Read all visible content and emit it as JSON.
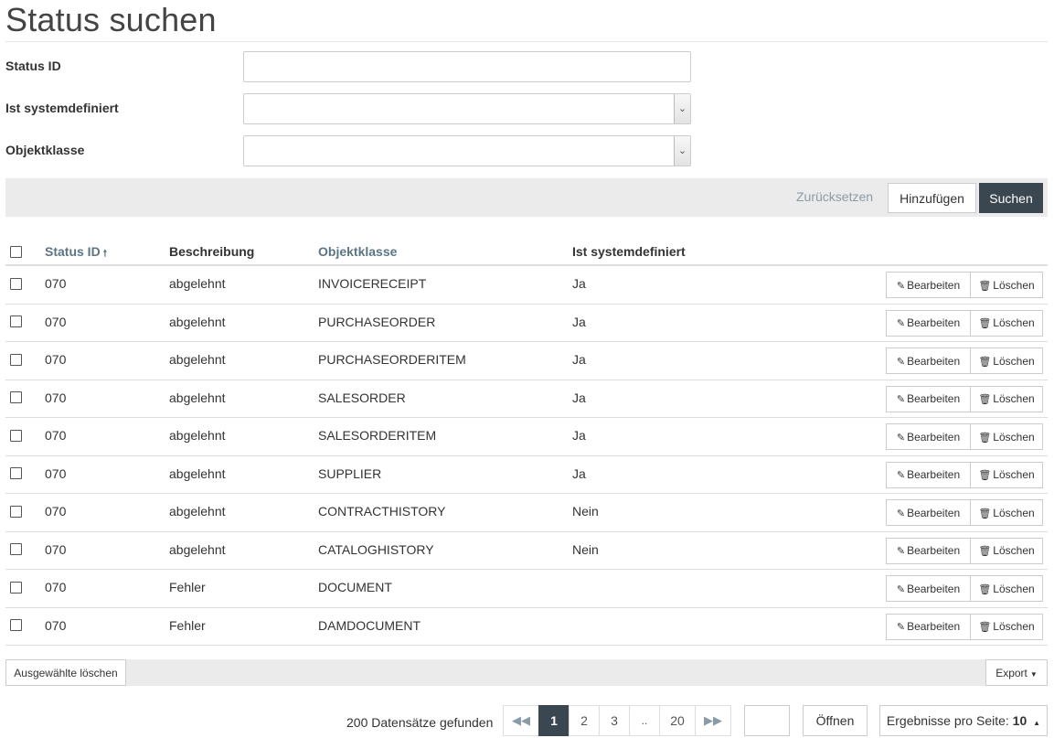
{
  "page": {
    "title": "Status suchen"
  },
  "form": {
    "status_id": {
      "label": "Status ID",
      "value": ""
    },
    "ist_systemdefiniert": {
      "label": "Ist systemdefiniert",
      "value": ""
    },
    "objektklasse": {
      "label": "Objektklasse",
      "value": ""
    }
  },
  "actions": {
    "reset_label": "Zurücksetzen",
    "add_label": "Hinzufügen",
    "search_label": "Suchen"
  },
  "grid": {
    "columns": {
      "status_id": "Status ID",
      "beschreibung": "Beschreibung",
      "objektklasse": "Objektklasse",
      "ist_systemdefiniert": "Ist systemdefiniert"
    },
    "sort_icon": "arrow-up-icon",
    "row_actions": {
      "edit_label": "Bearbeiten",
      "delete_label": "Löschen",
      "edit_icon": "pencil-icon",
      "delete_icon": "trash-icon"
    },
    "rows": [
      {
        "status_id": "070",
        "beschreibung": "abgelehnt",
        "objektklasse": "INVOICERECEIPT",
        "ist_systemdefiniert": "Ja"
      },
      {
        "status_id": "070",
        "beschreibung": "abgelehnt",
        "objektklasse": "PURCHASEORDER",
        "ist_systemdefiniert": "Ja"
      },
      {
        "status_id": "070",
        "beschreibung": "abgelehnt",
        "objektklasse": "PURCHASEORDERITEM",
        "ist_systemdefiniert": "Ja"
      },
      {
        "status_id": "070",
        "beschreibung": "abgelehnt",
        "objektklasse": "SALESORDER",
        "ist_systemdefiniert": "Ja"
      },
      {
        "status_id": "070",
        "beschreibung": "abgelehnt",
        "objektklasse": "SALESORDERITEM",
        "ist_systemdefiniert": "Ja"
      },
      {
        "status_id": "070",
        "beschreibung": "abgelehnt",
        "objektklasse": "SUPPLIER",
        "ist_systemdefiniert": "Ja"
      },
      {
        "status_id": "070",
        "beschreibung": "abgelehnt",
        "objektklasse": "CONTRACTHISTORY",
        "ist_systemdefiniert": "Nein"
      },
      {
        "status_id": "070",
        "beschreibung": "abgelehnt",
        "objektklasse": "CATALOGHISTORY",
        "ist_systemdefiniert": "Nein"
      },
      {
        "status_id": "070",
        "beschreibung": "Fehler",
        "objektklasse": "DOCUMENT",
        "ist_systemdefiniert": ""
      },
      {
        "status_id": "070",
        "beschreibung": "Fehler",
        "objektklasse": "DAMDOCUMENT",
        "ist_systemdefiniert": ""
      }
    ]
  },
  "bulk": {
    "delete_selected_label": "Ausgewählte löschen",
    "export_label": "Export"
  },
  "pagination": {
    "records_found": "200 Datensätze gefunden",
    "pages": [
      "1",
      "2",
      "3",
      "..",
      "20"
    ],
    "current_page": "1",
    "first_icon": "double-chevron-left-icon",
    "last_icon": "double-chevron-right-icon",
    "goto_value": "",
    "open_label": "Öffnen",
    "per_page_label": "Ergebnisse pro Seite:",
    "per_page_value": "10"
  },
  "colors": {
    "accent_dark": "#3b4750",
    "link": "#5b7585",
    "bar_bg": "#ebebeb"
  }
}
